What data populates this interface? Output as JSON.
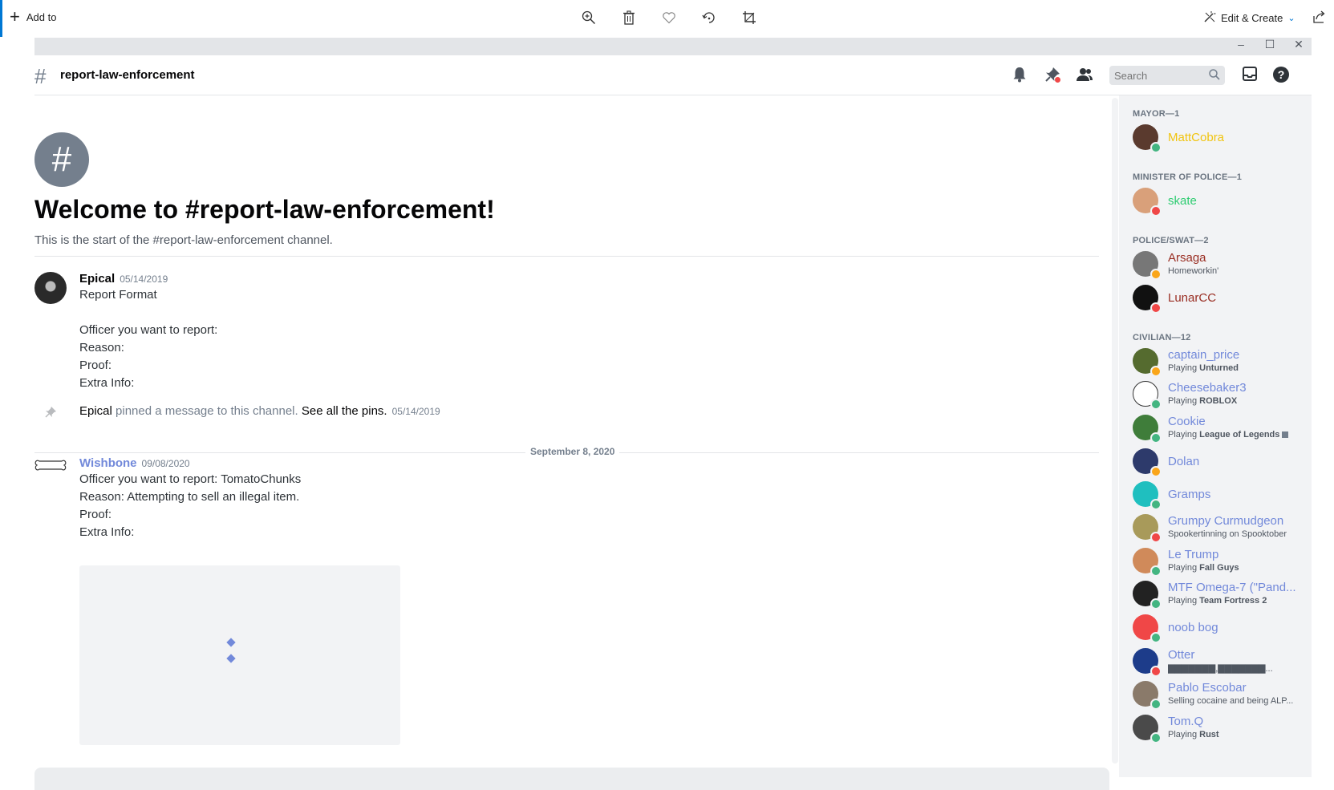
{
  "photos_toolbar": {
    "add_to_label": "Add to",
    "icons": [
      "zoom-in-icon",
      "delete-icon",
      "heart-icon",
      "rotate-icon",
      "crop-icon"
    ],
    "edit_create_label": "Edit & Create",
    "accent_color": "#0078d4"
  },
  "header": {
    "channel_name": "report-law-enforcement",
    "search_placeholder": "Search"
  },
  "welcome": {
    "title": "Welcome to #report-law-enforcement!",
    "subtitle": "This is the start of the #report-law-enforcement channel."
  },
  "messages": [
    {
      "author": "Epical",
      "timestamp": "05/14/2019",
      "lines": [
        "Report Format",
        "",
        "Officer you  want to report:",
        "Reason:",
        "Proof:",
        "Extra Info:"
      ]
    },
    {
      "system_author": "Epical",
      "system_text": " pinned a message to this channel. ",
      "system_link": "See all the pins.",
      "timestamp": "05/14/2019"
    },
    {
      "author": "Wishbone",
      "author_color": "#7289da",
      "timestamp": "09/08/2020",
      "lines": [
        "Officer you  want to report: TomatoChunks",
        "Reason: Attempting to sell an illegal item.",
        "Proof:",
        "Extra Info:"
      ]
    }
  ],
  "date_separator": "September 8, 2020",
  "members": {
    "roles": [
      {
        "name": "MAYOR—1",
        "members": [
          {
            "name": "MattCobra",
            "color": "#f1c40f",
            "status": "online",
            "activity": ""
          }
        ]
      },
      {
        "name": "MINISTER OF POLICE—1",
        "members": [
          {
            "name": "skate",
            "color": "#2ecc71",
            "status": "dnd",
            "activity": ""
          }
        ]
      },
      {
        "name": "POLICE/SWAT—2",
        "members": [
          {
            "name": "Arsaga",
            "color": "#992d22",
            "status": "idle",
            "activity": "Homeworkin'"
          },
          {
            "name": "LunarCC",
            "color": "#992d22",
            "status": "dnd",
            "activity": ""
          }
        ]
      },
      {
        "name": "CIVILIAN—12",
        "members": [
          {
            "name": "captain_price",
            "color": "#7289da",
            "status": "idle",
            "activity_prefix": "Playing ",
            "activity_game": "Unturned"
          },
          {
            "name": "Cheesebaker3",
            "color": "#7289da",
            "status": "online",
            "activity_prefix": "Playing ",
            "activity_game": "ROBLOX"
          },
          {
            "name": "Cookie",
            "color": "#7289da",
            "status": "online",
            "activity_prefix": "Playing ",
            "activity_game": "League of Legends"
          },
          {
            "name": "Dolan",
            "color": "#7289da",
            "status": "idle",
            "activity": ""
          },
          {
            "name": "Gramps",
            "color": "#7289da",
            "status": "online",
            "activity": ""
          },
          {
            "name": "Grumpy Curmudgeon",
            "color": "#7289da",
            "status": "dnd",
            "activity": "Spookertinning on Spooktober"
          },
          {
            "name": "Le Trump",
            "color": "#7289da",
            "status": "online",
            "activity_prefix": "Playing ",
            "activity_game": "Fall Guys"
          },
          {
            "name": "MTF Omega-7 (\"Pand...",
            "color": "#7289da",
            "status": "online",
            "activity_prefix": "Playing ",
            "activity_game": "Team Fortress 2"
          },
          {
            "name": "noob bog",
            "color": "#7289da",
            "status": "online",
            "activity": ""
          },
          {
            "name": "Otter",
            "color": "#7289da",
            "status": "dnd",
            "activity": "▇▇▇▇▇▇▇,▇▇▇▇▇▇▇..."
          },
          {
            "name": "Pablo Escobar",
            "color": "#7289da",
            "status": "online",
            "activity": "Selling cocaine and being ALP..."
          },
          {
            "name": "Tom.Q",
            "color": "#7289da",
            "status": "online",
            "activity_prefix": "Playing ",
            "activity_game": "Rust"
          }
        ]
      }
    ],
    "status_colors": {
      "online": "#43b581",
      "idle": "#faa61a",
      "dnd": "#f04747"
    }
  }
}
